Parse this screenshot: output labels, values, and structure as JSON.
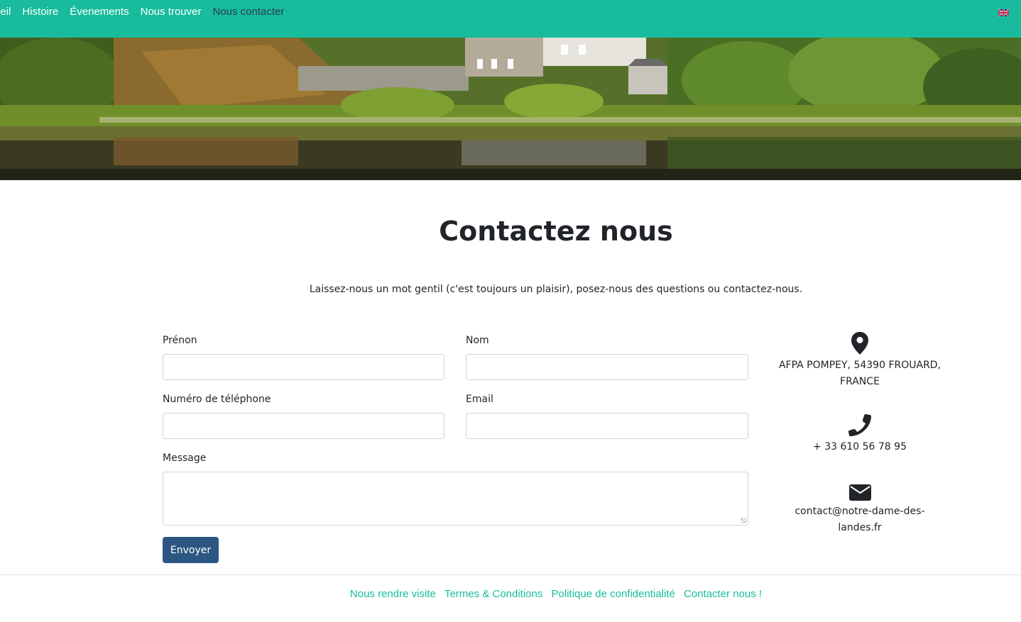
{
  "nav": {
    "items": [
      {
        "label": "ueil",
        "active": false
      },
      {
        "label": "Histoire",
        "active": false
      },
      {
        "label": "Évenements",
        "active": false
      },
      {
        "label": "Nous trouver",
        "active": false
      },
      {
        "label": "Nous contacter",
        "active": true
      }
    ],
    "language_icon": "uk-flag-icon"
  },
  "hero": {
    "image": "lakeside-village-photo"
  },
  "main": {
    "title": "Contactez nous",
    "intro": "Laissez-nous un mot gentil (c'est toujours un plaisir), posez-nous des questions ou contactez-nous."
  },
  "form": {
    "first_name": {
      "label": "Prénon",
      "value": ""
    },
    "last_name": {
      "label": "Nom",
      "value": ""
    },
    "phone": {
      "label": "Numéro de téléphone",
      "value": ""
    },
    "email": {
      "label": "Email",
      "value": ""
    },
    "message": {
      "label": "Message",
      "value": ""
    },
    "submit_label": "Envoyer"
  },
  "contact": {
    "address_line1": "AFPA POMPEY, 54390 FROUARD,",
    "address_line2": "FRANCE",
    "phone": "+ 33 610 56 78 95",
    "email": "contact@notre-dame-des-landes.fr",
    "icons": [
      "map-pin-icon",
      "phone-icon",
      "envelope-icon"
    ]
  },
  "footer": {
    "links": [
      "Nous rendre visite",
      "Termes & Conditions",
      "Politique de confidentialité",
      "Contacter nous !"
    ]
  },
  "colors": {
    "navbar": "#18bc9c",
    "active_link": "#2c3e50",
    "button": "#2c5782",
    "footer_link": "#18bc9c"
  }
}
